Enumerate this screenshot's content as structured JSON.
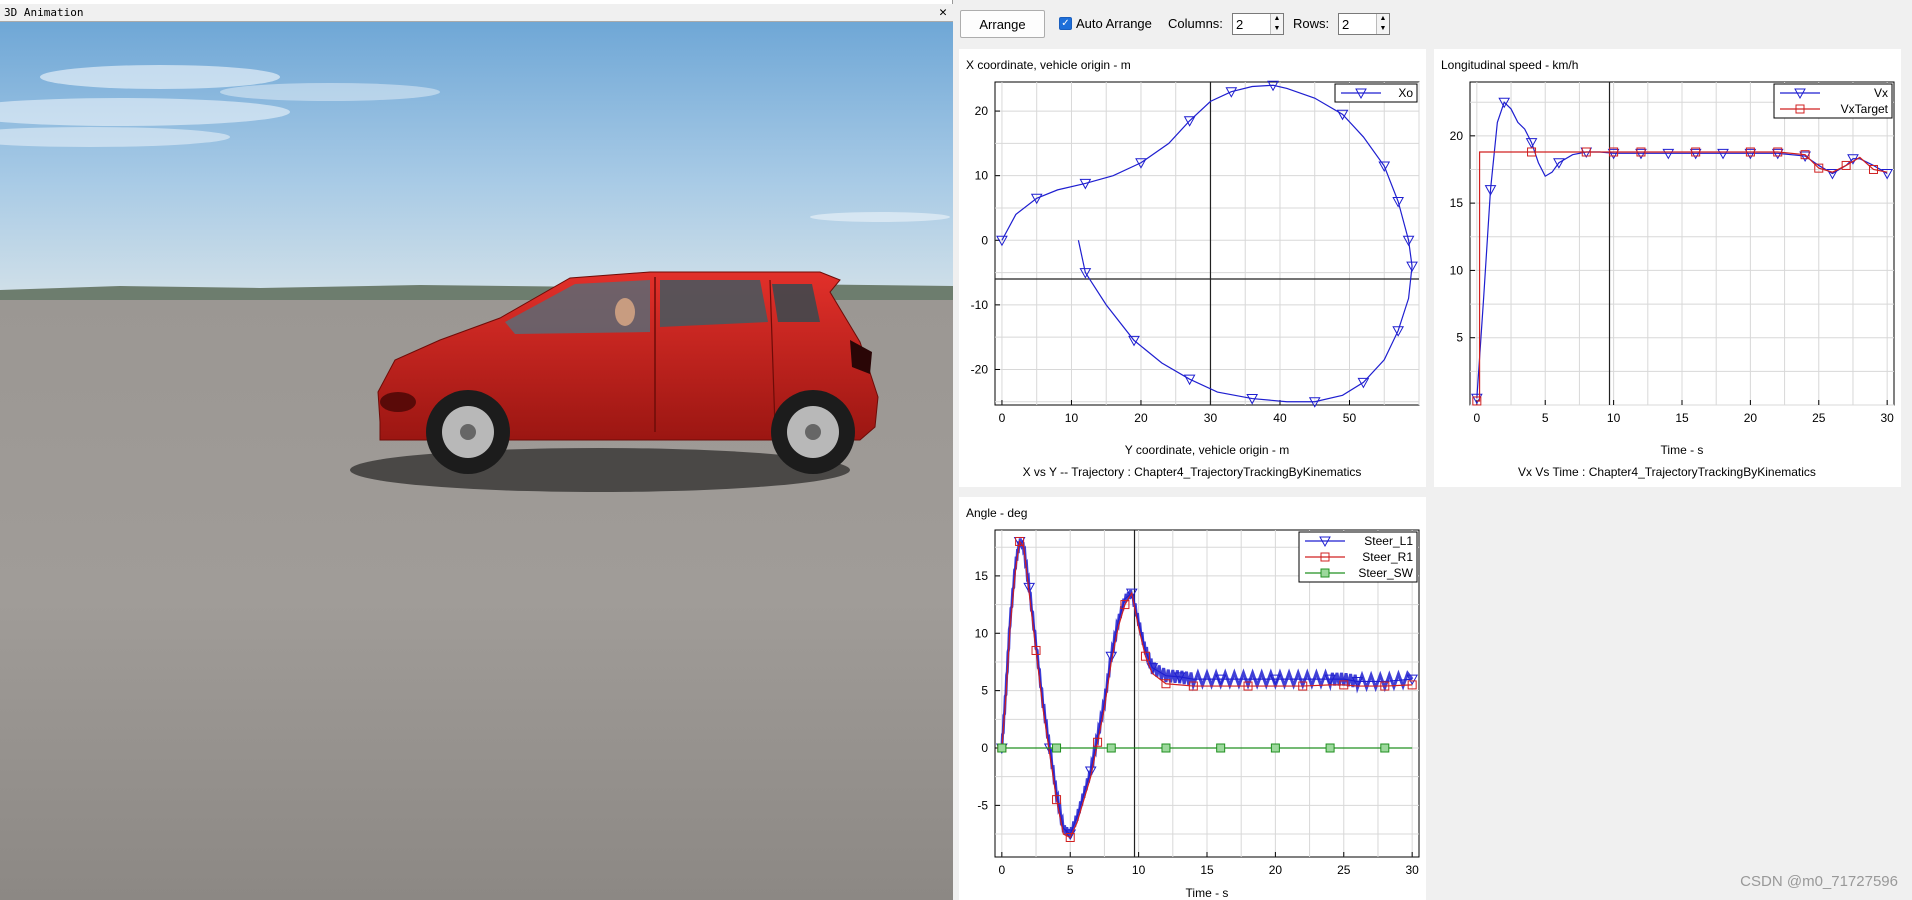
{
  "window": {
    "title": "3D Animation",
    "close_glyph": "✕"
  },
  "toolbar": {
    "arrange_label": "Arrange",
    "auto_arrange_label": "Auto Arrange",
    "auto_arrange_checked": true,
    "columns_label": "Columns:",
    "columns_value": "2",
    "rows_label": "Rows:",
    "rows_value": "2"
  },
  "watermark": "CSDN @m0_71727596",
  "colors": {
    "blue": "#1f1fd0",
    "red": "#d02020",
    "green": "#209020",
    "grid": "#d8d8d8"
  },
  "chart_data": [
    {
      "id": "xy",
      "type": "line",
      "title": "X coordinate, vehicle origin - m",
      "xlabel": "Y coordinate, vehicle origin - m",
      "caption": "X vs Y -- Trajectory : Chapter4_TrajectoryTrackingByKinematics",
      "xlim": [
        -1,
        60
      ],
      "ylim": [
        -25.5,
        24.5
      ],
      "xticks": [
        0,
        10,
        20,
        30,
        40,
        50
      ],
      "yticks": [
        -20,
        -10,
        0,
        10,
        20
      ],
      "grid": true,
      "legend_position": "top-right",
      "cursor_x": 30,
      "cursor_y": -6,
      "series": [
        {
          "name": "Xo",
          "color": "blue",
          "marker": "tri",
          "x": [
            0,
            2,
            5,
            8,
            12,
            16,
            20,
            24,
            27,
            30,
            33,
            36,
            39,
            41,
            45,
            49,
            52,
            55,
            57,
            58.5,
            59,
            58.5,
            57,
            55,
            52,
            49,
            45,
            41,
            36,
            31,
            27,
            23,
            19,
            15,
            12,
            11
          ],
          "y": [
            0,
            4,
            6.5,
            7.8,
            8.8,
            10,
            12,
            15,
            18.5,
            21.5,
            23,
            23.8,
            24,
            23.5,
            22,
            19.5,
            16,
            11.5,
            6,
            0,
            -4,
            -9,
            -14,
            -18.5,
            -22,
            -24,
            -25,
            -25,
            -24.5,
            -23.5,
            -21.5,
            -19,
            -15.5,
            -10,
            -5,
            0
          ],
          "marker_idx": [
            0,
            2,
            4,
            6,
            8,
            10,
            12,
            15,
            17,
            18,
            19,
            20,
            22,
            24,
            26,
            28,
            30,
            32,
            34
          ]
        }
      ]
    },
    {
      "id": "vx",
      "type": "line",
      "title": "Longitudinal speed - km/h",
      "xlabel": "Time - s",
      "caption": "Vx Vs Time : Chapter4_TrajectoryTrackingByKinematics",
      "xlim": [
        -0.5,
        30.5
      ],
      "ylim": [
        0,
        24
      ],
      "xticks": [
        0,
        5,
        10,
        15,
        20,
        25,
        30
      ],
      "yticks": [
        5,
        10,
        15,
        20
      ],
      "grid": true,
      "legend_position": "top-right",
      "cursor_x": 9.7,
      "series": [
        {
          "name": "Vx",
          "color": "blue",
          "marker": "tri",
          "x": [
            0,
            0.5,
            1,
            1.5,
            2,
            2.5,
            3,
            3.5,
            4,
            4.5,
            5,
            5.5,
            6,
            7,
            8,
            9,
            10,
            12,
            14,
            16,
            18,
            20,
            22,
            24,
            25,
            26,
            27,
            27.5,
            28,
            29,
            30
          ],
          "y": [
            0.5,
            8,
            16,
            21,
            22.5,
            22,
            21,
            20.5,
            19.5,
            18,
            17,
            17.3,
            18,
            18.6,
            18.8,
            18.8,
            18.7,
            18.7,
            18.7,
            18.7,
            18.7,
            18.7,
            18.7,
            18.5,
            17.8,
            17.2,
            17.8,
            18.3,
            18.3,
            17.8,
            17.2
          ],
          "marker_idx": [
            0,
            2,
            4,
            8,
            12,
            14,
            16,
            17,
            18,
            19,
            20,
            21,
            22,
            23,
            25,
            27,
            30
          ]
        },
        {
          "name": "VxTarget",
          "color": "red",
          "marker": "sq",
          "x": [
            0,
            0.2,
            0.2,
            2,
            4,
            6,
            8,
            10,
            12,
            14,
            16,
            18,
            20,
            22,
            24,
            25,
            26,
            27,
            28,
            29,
            30
          ],
          "y": [
            0.3,
            0.3,
            18.8,
            18.8,
            18.8,
            18.8,
            18.8,
            18.8,
            18.8,
            18.8,
            18.8,
            18.8,
            18.8,
            18.8,
            18.6,
            17.6,
            17.3,
            17.8,
            18.4,
            17.5,
            17.3
          ],
          "marker_idx": [
            0,
            4,
            6,
            7,
            8,
            10,
            12,
            13,
            14,
            15,
            17,
            19
          ]
        }
      ]
    },
    {
      "id": "steer",
      "type": "line",
      "title": "Angle - deg",
      "xlabel": "Time - s",
      "xlim": [
        -0.5,
        30.5
      ],
      "ylim": [
        -9.5,
        19
      ],
      "xticks": [
        0,
        5,
        10,
        15,
        20,
        25,
        30
      ],
      "yticks": [
        -5,
        0,
        5,
        10,
        15
      ],
      "grid": true,
      "legend_position": "top-right",
      "cursor_x": 9.7,
      "series": [
        {
          "name": "Steer_L1",
          "color": "blue",
          "marker": "tri",
          "x": [
            0,
            0.3,
            0.6,
            1,
            1.3,
            1.6,
            2,
            2.5,
            3,
            3.5,
            4,
            4.5,
            5,
            5.5,
            6,
            6.5,
            7,
            7.5,
            8,
            8.5,
            9,
            9.5,
            10,
            10.5,
            11,
            12,
            13,
            14,
            16,
            18,
            20,
            22,
            24,
            25,
            26,
            28,
            30
          ],
          "y": [
            0,
            5,
            11,
            16,
            18,
            17.5,
            14,
            9,
            4,
            0,
            -4,
            -7,
            -7.5,
            -6,
            -4,
            -2,
            1,
            4,
            8,
            11,
            13,
            13.5,
            11,
            8.5,
            7,
            6.3,
            6.2,
            6,
            6,
            6,
            6,
            6,
            6,
            6,
            5.8,
            5.8,
            6
          ],
          "marker_idx": [
            0,
            4,
            6,
            9,
            12,
            15,
            18,
            21,
            24,
            26,
            28,
            30,
            32,
            34,
            36
          ],
          "noise": true
        },
        {
          "name": "Steer_R1",
          "color": "red",
          "marker": "sq",
          "x": [
            0,
            0.3,
            0.6,
            1,
            1.3,
            1.6,
            2,
            2.5,
            3,
            3.5,
            4,
            4.5,
            5,
            5.5,
            6,
            6.5,
            7,
            7.5,
            8,
            8.5,
            9,
            9.5,
            10,
            10.5,
            11,
            12,
            13,
            14,
            16,
            18,
            20,
            22,
            24,
            25,
            26,
            28,
            30
          ],
          "y": [
            0,
            4.5,
            10.5,
            15.5,
            18,
            17.5,
            13.5,
            8.5,
            3.5,
            -0.5,
            -4.5,
            -7.5,
            -7.8,
            -6.5,
            -4.5,
            -2.5,
            0.5,
            3.5,
            7.5,
            10.5,
            12.5,
            13.5,
            10.5,
            8,
            6.5,
            5.6,
            5.5,
            5.4,
            5.4,
            5.4,
            5.4,
            5.4,
            5.5,
            5.5,
            5.4,
            5.4,
            5.5
          ],
          "marker_idx": [
            0,
            4,
            7,
            10,
            12,
            16,
            20,
            23,
            25,
            27,
            29,
            31,
            33,
            35,
            36
          ]
        },
        {
          "name": "Steer_SW",
          "color": "green",
          "marker": "sq",
          "x": [
            0,
            2,
            4,
            6,
            8,
            10,
            12,
            14,
            16,
            18,
            20,
            22,
            24,
            26,
            28,
            30
          ],
          "y": [
            0,
            0,
            0,
            0,
            0,
            0,
            0,
            0,
            0,
            0,
            0,
            0,
            0,
            0,
            0,
            0
          ],
          "marker_idx": [
            0,
            2,
            4,
            6,
            8,
            10,
            12,
            14
          ]
        }
      ]
    }
  ]
}
